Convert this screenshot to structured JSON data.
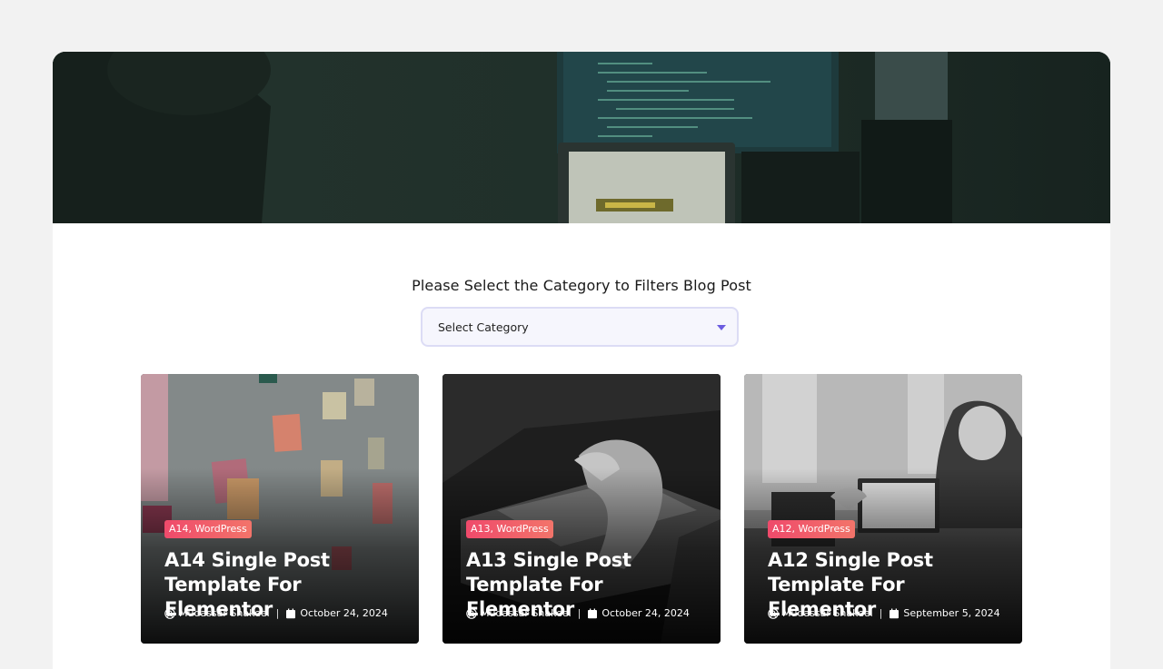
{
  "filter": {
    "heading": "Please Select the Category to Filters Blog Post",
    "select_value": "Select Category"
  },
  "posts": [
    {
      "badge": "A14, WordPress",
      "title": "A14 Single Post Template For Elementor",
      "author": "Mudassar Shakeel",
      "date": "October 24, 2024"
    },
    {
      "badge": "A13, WordPress",
      "title": "A13 Single Post Template For Elementor",
      "author": "Mudassar Shakeel",
      "date": "October 24, 2024"
    },
    {
      "badge": "A12, WordPress",
      "title": "A12 Single Post Template For Elementor",
      "author": "Mudassar Shakeel",
      "date": "September 5, 2024"
    }
  ],
  "colors": {
    "badge_start": "#ef4a6b",
    "badge_end": "#f2746a",
    "select_caret": "#6b5ce0",
    "hero_tint": "#1c2b26"
  },
  "icons": {
    "author": "user-circle-icon",
    "date": "calendar-icon",
    "select": "chevron-down-icon"
  }
}
